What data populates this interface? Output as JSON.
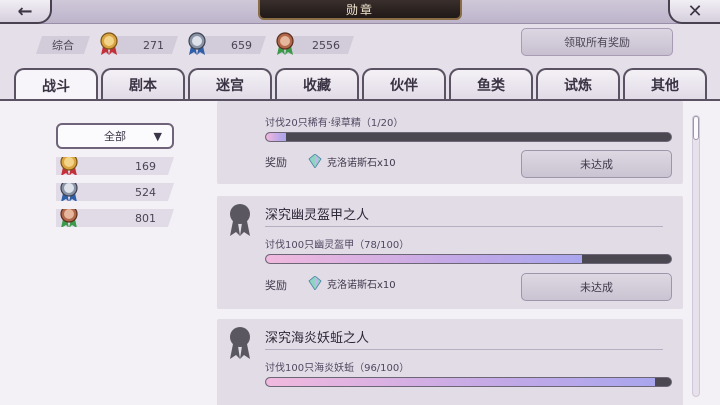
{
  "header": {
    "title": "勋章",
    "back_icon": "back-arrow-icon",
    "close_icon": "close-icon"
  },
  "summary": {
    "label": "综合",
    "gold_count": "271",
    "silver_count": "659",
    "bronze_count": "2556",
    "claim_all_label": "领取所有奖励"
  },
  "tabs": [
    {
      "label": "战斗",
      "active": true
    },
    {
      "label": "剧本",
      "active": false
    },
    {
      "label": "迷宫",
      "active": false
    },
    {
      "label": "收藏",
      "active": false
    },
    {
      "label": "伙伴",
      "active": false
    },
    {
      "label": "鱼类",
      "active": false
    },
    {
      "label": "试炼",
      "active": false
    },
    {
      "label": "其他",
      "active": false
    }
  ],
  "filter": {
    "selected": "全部",
    "counts": {
      "gold": "169",
      "silver": "524",
      "bronze": "801"
    }
  },
  "achievements": [
    {
      "title": "",
      "desc": "讨伐20只稀有·绿草精（1/20）",
      "progress": 0.05,
      "reward_label": "奖励",
      "reward": "克洛诺斯石x10",
      "status": "未达成"
    },
    {
      "title": "深究幽灵盔甲之人",
      "desc": "讨伐100只幽灵盔甲（78/100）",
      "progress": 0.78,
      "reward_label": "奖励",
      "reward": "克洛诺斯石x10",
      "status": "未达成"
    },
    {
      "title": "深究海炎妖蚯之人",
      "desc": "讨伐100只海炎妖蚯（96/100）",
      "progress": 0.96
    }
  ],
  "colors": {
    "gold_medal": "#d9a441",
    "silver_medal": "#8a93a6",
    "bronze_medal": "#b0674a",
    "ribbon_red": "#c4303a",
    "ribbon_blue": "#2f5fa8",
    "ribbon_green": "#3a9a4a"
  }
}
